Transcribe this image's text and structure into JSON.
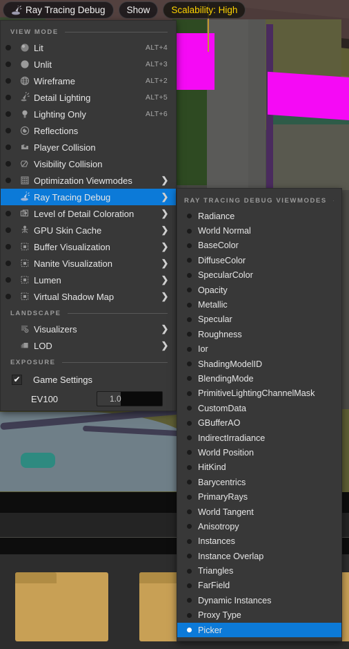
{
  "toolbar": {
    "viewmode_button": "Ray Tracing Debug",
    "viewmode_icon": "ray-tracing-debug-icon",
    "show_button": "Show",
    "scalability_button": "Scalability: High",
    "scalability_color": "#ffd400"
  },
  "main_menu": {
    "sections": [
      {
        "title": "VIEW MODE"
      },
      {
        "title": "LANDSCAPE"
      },
      {
        "title": "EXPOSURE"
      }
    ],
    "view_mode_items": [
      {
        "label": "Lit",
        "shortcut": "ALT+4",
        "icon": "lit-sphere-icon",
        "submenu": false,
        "selected": false
      },
      {
        "label": "Unlit",
        "shortcut": "ALT+3",
        "icon": "unlit-sphere-icon",
        "submenu": false,
        "selected": false
      },
      {
        "label": "Wireframe",
        "shortcut": "ALT+2",
        "icon": "wireframe-globe-icon",
        "submenu": false,
        "selected": false
      },
      {
        "label": "Detail Lighting",
        "shortcut": "ALT+5",
        "icon": "flashlight-icon",
        "submenu": false,
        "selected": false
      },
      {
        "label": "Lighting Only",
        "shortcut": "ALT+6",
        "icon": "lightbulb-icon",
        "submenu": false,
        "selected": false
      },
      {
        "label": "Reflections",
        "shortcut": "",
        "icon": "reflections-icon",
        "submenu": false,
        "selected": false
      },
      {
        "label": "Player Collision",
        "shortcut": "",
        "icon": "player-collision-icon",
        "submenu": false,
        "selected": false
      },
      {
        "label": "Visibility Collision",
        "shortcut": "",
        "icon": "visibility-collision-icon",
        "submenu": false,
        "selected": false
      },
      {
        "label": "Optimization Viewmodes",
        "shortcut": "",
        "icon": "grid-icon",
        "submenu": true,
        "selected": false
      },
      {
        "label": "Ray Tracing Debug",
        "shortcut": "",
        "icon": "ray-tracing-debug-icon",
        "submenu": true,
        "selected": true
      },
      {
        "label": "Level of Detail Coloration",
        "shortcut": "",
        "icon": "lod-coloration-icon",
        "submenu": true,
        "selected": false
      },
      {
        "label": "GPU Skin Cache",
        "shortcut": "",
        "icon": "skeleton-icon",
        "submenu": true,
        "selected": false
      },
      {
        "label": "Buffer Visualization",
        "shortcut": "",
        "icon": "buffer-visualization-icon",
        "submenu": true,
        "selected": false
      },
      {
        "label": "Nanite Visualization",
        "shortcut": "",
        "icon": "nanite-visualization-icon",
        "submenu": true,
        "selected": false
      },
      {
        "label": "Lumen",
        "shortcut": "",
        "icon": "lumen-icon",
        "submenu": true,
        "selected": false
      },
      {
        "label": "Virtual Shadow Map",
        "shortcut": "",
        "icon": "virtual-shadow-map-icon",
        "submenu": true,
        "selected": false
      }
    ],
    "landscape_items": [
      {
        "label": "Visualizers",
        "icon": "visualizers-icon",
        "submenu": true
      },
      {
        "label": "LOD",
        "icon": "lod-icon",
        "submenu": true
      }
    ],
    "exposure": {
      "game_settings_label": "Game Settings",
      "game_settings_checked": true,
      "ev100_label": "EV100",
      "ev100_value": "1.0",
      "ev100_fill_percent": 36
    }
  },
  "sub_menu": {
    "title": "RAY TRACING DEBUG VIEWMODES",
    "items": [
      {
        "label": "Radiance",
        "selected": false
      },
      {
        "label": "World Normal",
        "selected": false
      },
      {
        "label": "BaseColor",
        "selected": false
      },
      {
        "label": "DiffuseColor",
        "selected": false
      },
      {
        "label": "SpecularColor",
        "selected": false
      },
      {
        "label": "Opacity",
        "selected": false
      },
      {
        "label": "Metallic",
        "selected": false
      },
      {
        "label": "Specular",
        "selected": false
      },
      {
        "label": "Roughness",
        "selected": false
      },
      {
        "label": "Ior",
        "selected": false
      },
      {
        "label": "ShadingModelID",
        "selected": false
      },
      {
        "label": "BlendingMode",
        "selected": false
      },
      {
        "label": "PrimitiveLightingChannelMask",
        "selected": false
      },
      {
        "label": "CustomData",
        "selected": false
      },
      {
        "label": "GBufferAO",
        "selected": false
      },
      {
        "label": "IndirectIrradiance",
        "selected": false
      },
      {
        "label": "World Position",
        "selected": false
      },
      {
        "label": "HitKind",
        "selected": false
      },
      {
        "label": "Barycentrics",
        "selected": false
      },
      {
        "label": "PrimaryRays",
        "selected": false
      },
      {
        "label": "World Tangent",
        "selected": false
      },
      {
        "label": "Anisotropy",
        "selected": false
      },
      {
        "label": "Instances",
        "selected": false
      },
      {
        "label": "Instance Overlap",
        "selected": false
      },
      {
        "label": "Triangles",
        "selected": false
      },
      {
        "label": "FarField",
        "selected": false
      },
      {
        "label": "Dynamic Instances",
        "selected": false
      },
      {
        "label": "Proxy Type",
        "selected": false
      },
      {
        "label": "Picker",
        "selected": true
      }
    ]
  },
  "theme": {
    "menu_background": "#383838",
    "highlight_blue": "#0c7ad8",
    "text_primary": "#e6e6e6",
    "text_muted": "#9a9a9a"
  }
}
